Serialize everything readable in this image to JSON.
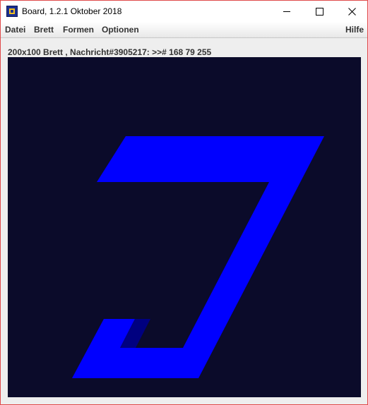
{
  "window": {
    "title": "Board, 1.2.1 Oktober 2018",
    "app_icon": "board-app-icon"
  },
  "controls": {
    "minimize": "minimize-icon",
    "maximize": "maximize-icon",
    "close": "close-icon",
    "close_glyph": "✕"
  },
  "menu": {
    "items": [
      {
        "label": "Datei"
      },
      {
        "label": "Brett"
      },
      {
        "label": "Formen"
      },
      {
        "label": "Optionen"
      }
    ],
    "help_label": "Hilfe"
  },
  "status": {
    "text": "200x100 Brett , Nachricht#3905217: >># 168 79 255"
  },
  "board": {
    "background_color": "#0b0b2a",
    "shape_color": "#0000ff",
    "shadow_color": "#000080"
  }
}
